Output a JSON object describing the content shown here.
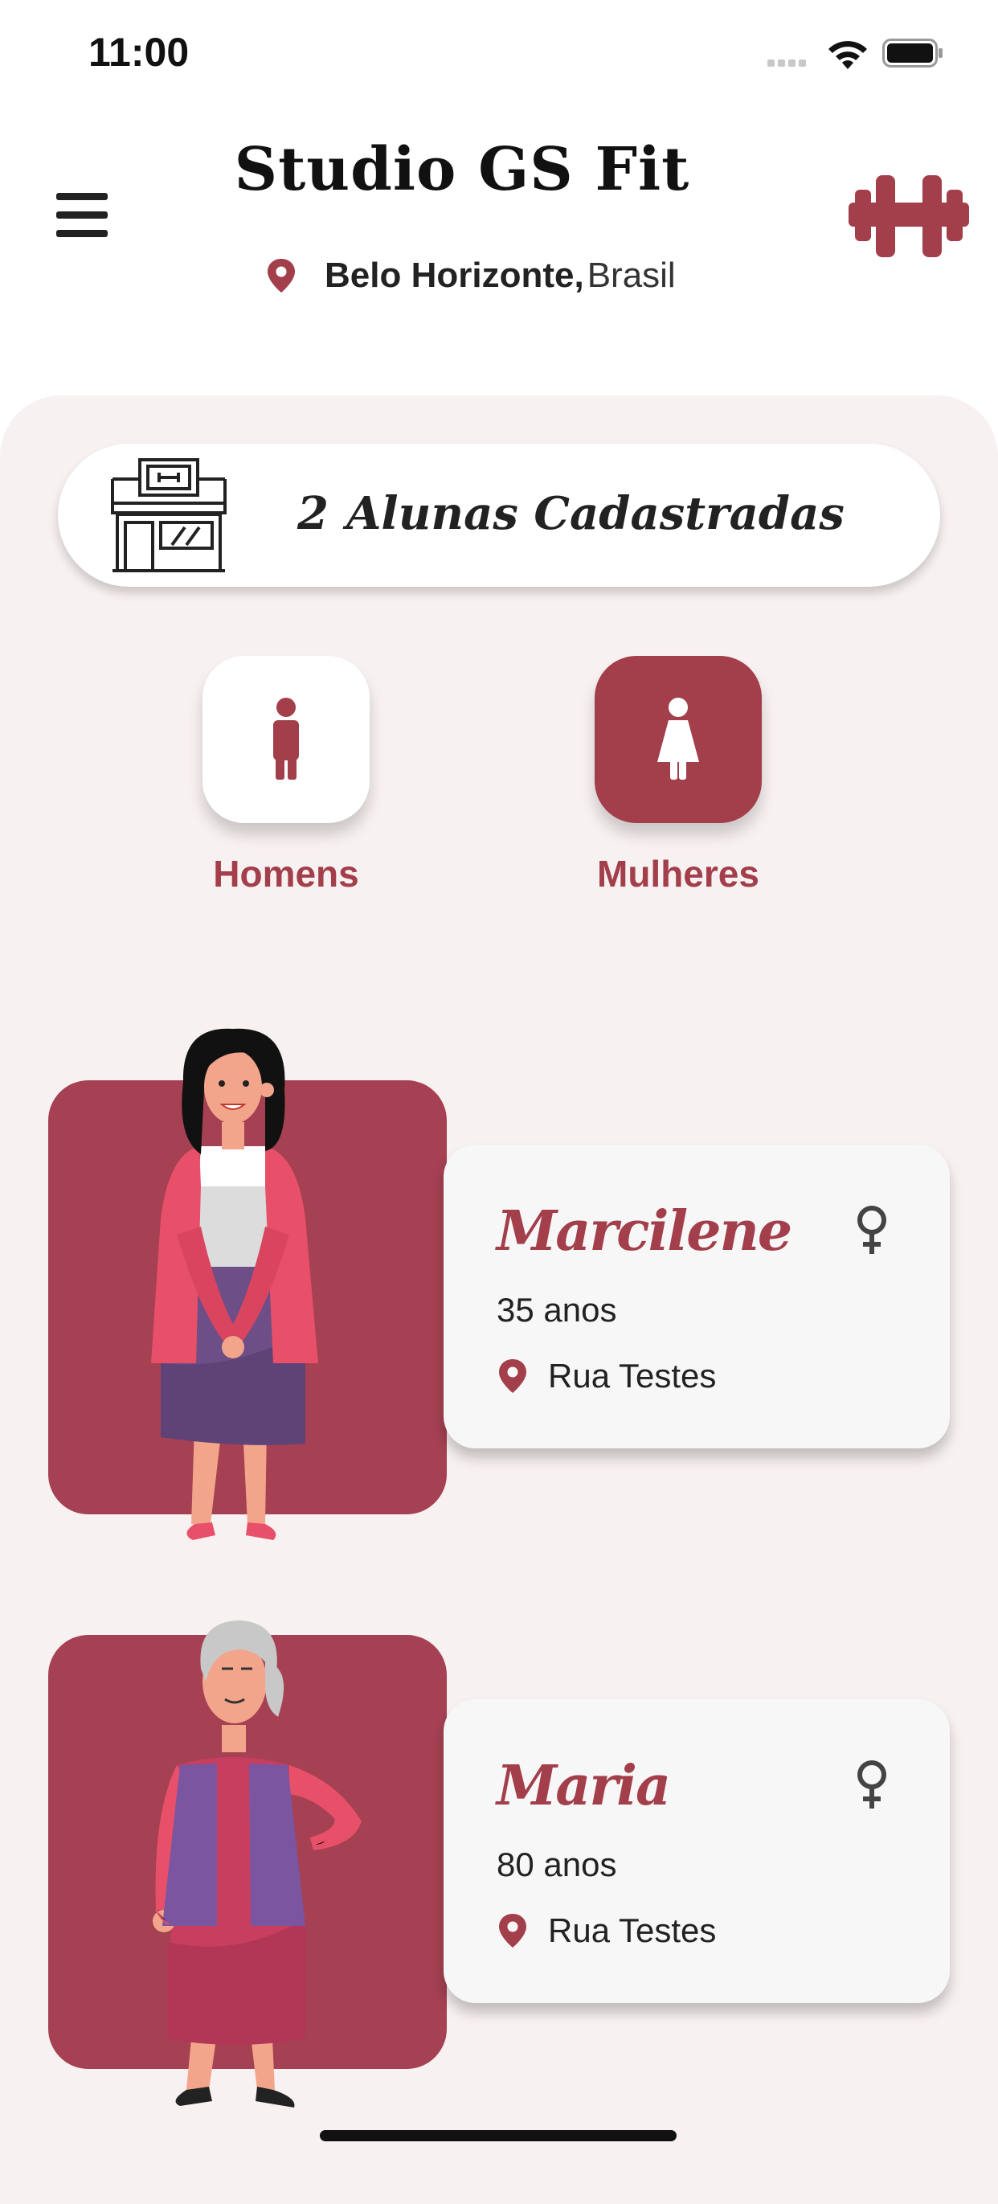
{
  "status_bar": {
    "time": "11:00"
  },
  "header": {
    "title": "Studio GS Fit",
    "location_city": "Belo Horizonte,",
    "location_country": "Brasil"
  },
  "summary": {
    "count": "2",
    "label": "Alunas Cadastradas"
  },
  "filters": {
    "men_label": "Homens",
    "women_label": "Mulheres",
    "selected": "Mulheres"
  },
  "students": [
    {
      "name": "Marcilene",
      "age": "35 anos",
      "address": "Rua Testes"
    },
    {
      "name": "Maria",
      "age": "80 anos",
      "address": "Rua Testes"
    }
  ],
  "colors": {
    "accent": "#a33e4b",
    "panel": "#f8f1f1",
    "photo_bg": "#a54152"
  }
}
